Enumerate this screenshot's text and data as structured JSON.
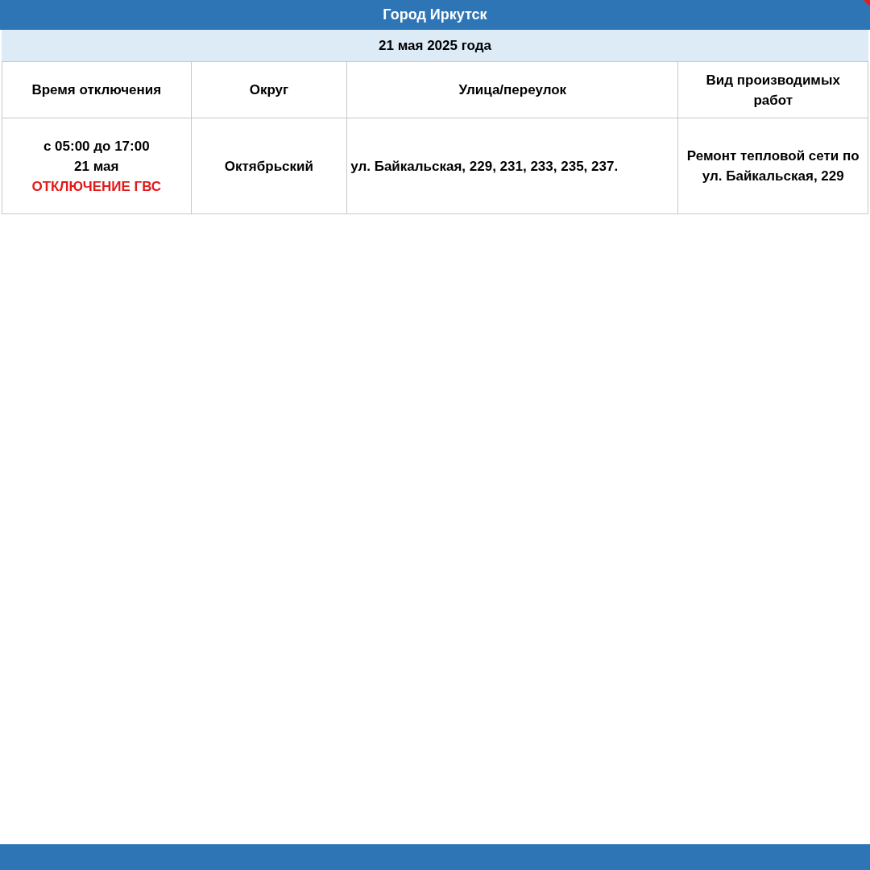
{
  "title": "Город Иркутск",
  "date": "21 мая 2025 года",
  "table": {
    "columns": [
      "Время отключения",
      "Округ",
      "Улица/переулок",
      "Вид производимых работ"
    ],
    "rows": [
      {
        "time": "с 05:00 до 17:00",
        "day": "21 мая",
        "alert": "ОТКЛЮЧЕНИЕ ГВС",
        "district": "Октябрьский",
        "street": "ул. Байкальская, 229, 231, 233, 235, 237.",
        "work": "Ремонт тепловой сети по ул. Байкальская, 229"
      }
    ]
  }
}
